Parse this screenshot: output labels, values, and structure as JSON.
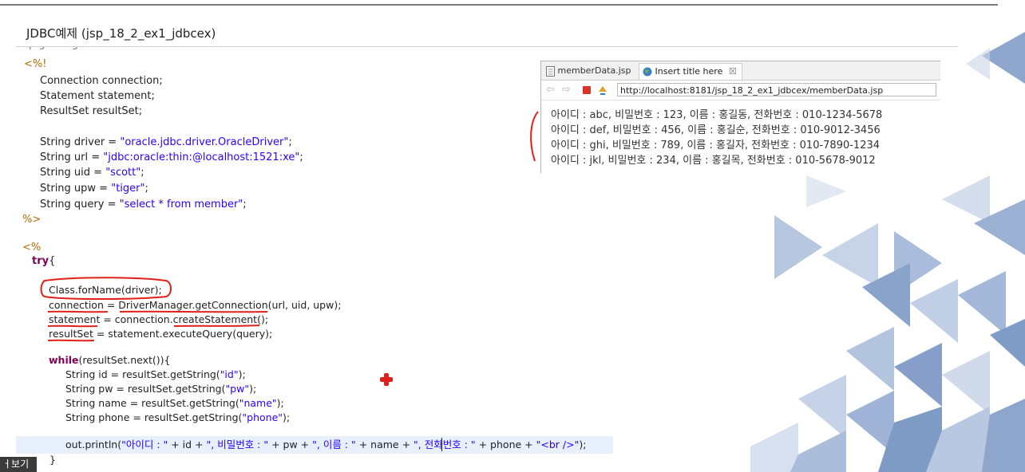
{
  "slide": {
    "title": "JDBC예제 (jsp_18_2_ex1_jdbcex)",
    "bottom_label": "ㅓ보기"
  },
  "code": {
    "decl_open": "<%!",
    "decl_lines": [
      {
        "pre": "Connection connection;"
      },
      {
        "pre": "Statement statement;"
      },
      {
        "pre": "ResultSet resultSet;"
      },
      {
        "pre": "String driver = ",
        "str": "\"oracle.jdbc.driver.OracleDriver\"",
        "post": ";"
      },
      {
        "pre": "String url = ",
        "str": "\"jdbc:oracle:thin:@localhost:1521:xe\"",
        "post": ";"
      },
      {
        "pre": "String uid = ",
        "str": "\"scott\"",
        "post": ";"
      },
      {
        "pre": "String upw = ",
        "str": "\"tiger\"",
        "post": ";"
      },
      {
        "pre": "String query = ",
        "str": "\"select * from member\"",
        "post": ";"
      }
    ],
    "decl_close": "%>",
    "scriptlet_open": "<%",
    "try_kw": "try",
    "try_brace": "{",
    "try_lines": [
      {
        "pre": "Class.forName(driver);"
      },
      {
        "pre": "connection = DriverManager.getConnection(url, uid, upw);"
      },
      {
        "pre": "statement = connection.createStatement();"
      },
      {
        "pre": "resultSet = statement.executeQuery(query);"
      }
    ],
    "while_kw": "while",
    "while_rest": "(resultSet.next()){",
    "while_lines": [
      {
        "pre": "String id = resultSet.getString(",
        "str": "\"id\"",
        "post": ");"
      },
      {
        "pre": "String pw = resultSet.getString(",
        "str": "\"pw\"",
        "post": ");"
      },
      {
        "pre": "String name = resultSet.getString(",
        "str": "\"name\"",
        "post": ");"
      },
      {
        "pre": "String phone = resultSet.getString(",
        "str": "\"phone\"",
        "post": ");"
      }
    ],
    "println": {
      "p1": "out.println(",
      "s1": "\"아이디 : \"",
      "p2": " + id + ",
      "s2": "\", 비밀번호 : \"",
      "p3": " + pw + ",
      "s3": "\", 이름 : \"",
      "p4": " + name + ",
      "s4": "\", 전화번호 : \"",
      "p5": " + phone + ",
      "s5": "\"<br />\"",
      "p6": ");"
    },
    "close_brace": "}"
  },
  "browser": {
    "tab1_label": "memberData.jsp",
    "tab2_label": "Insert title here",
    "tab2_close": "☒",
    "url": "http://localhost:8181/jsp_18_2_ex1_jdbcex/memberData.jsp",
    "results": [
      "아이디 : abc, 비밀번호 : 123, 이름 : 홍길동, 전화번호 : 010-1234-5678",
      "아이디 : def, 비밀번호 : 456, 이름 : 홍길순, 전화번호 : 010-9012-3456",
      "아이디 : ghi, 비밀번호 : 789, 이름 : 홍길자, 전화번호 : 010-7890-1234",
      "아이디 : jkl, 비밀번호 : 234, 이름 : 홍길목, 전화번호 : 010-5678-9012"
    ]
  },
  "colors": {
    "keyword": "#7f0055",
    "string": "#2a00ff",
    "jsp_tag": "#b36b00",
    "annotation_red": "#e0201a",
    "decor_blue": "#7f9cc6"
  },
  "icons": [
    "file-icon",
    "globe-icon",
    "back-icon",
    "forward-icon",
    "stop-icon",
    "refresh-icon",
    "red-cross-cursor-icon"
  ]
}
